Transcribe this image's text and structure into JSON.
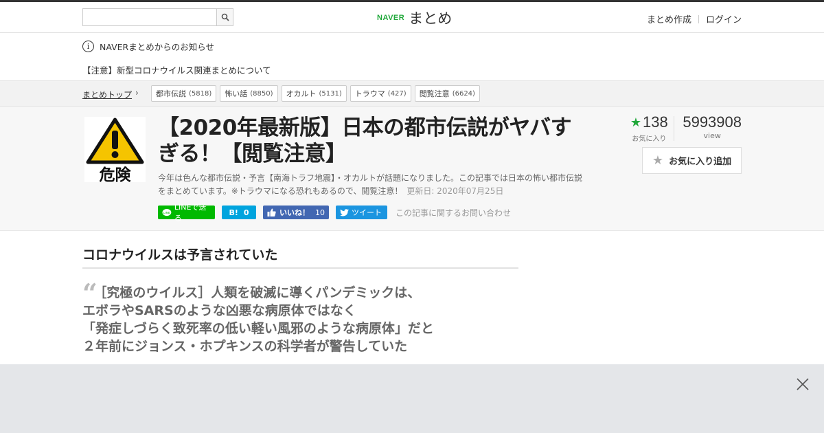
{
  "header": {
    "logo_naver": "NAVER",
    "logo_matome": "まとめ",
    "search_placeholder": "",
    "create_link": "まとめ作成",
    "login_link": "ログイン"
  },
  "notice": {
    "title": "NAVERまとめからのお知らせ",
    "item": "【注意】新型コロナウイルス関連まとめについて"
  },
  "breadcrumb": {
    "home": "まとめトップ",
    "tags": [
      {
        "label": "都市伝説",
        "count": "(5818)"
      },
      {
        "label": "怖い話",
        "count": "(8850)"
      },
      {
        "label": "オカルト",
        "count": "(5131)"
      },
      {
        "label": "トラウマ",
        "count": "(427)"
      },
      {
        "label": "閲覧注意",
        "count": "(6624)"
      }
    ]
  },
  "article": {
    "thumb_text": "危険",
    "title": "【2020年最新版】日本の都市伝説がヤバすぎる！【閲覧注意】",
    "description": "今年は色んな都市伝説・予言【南海トラフ地震】・オカルトが話題になりました。この記事では日本の怖い都市伝説をまとめています。※トラウマになる恐れもあるので、閲覧注意！",
    "updated": "更新日: 2020年07月25日",
    "favorites": "138",
    "favorites_label": "お気に入り",
    "views": "5993908",
    "views_label": "view",
    "fav_button": "お気に入り追加",
    "contact": "この記事に関するお問い合わせ"
  },
  "share": {
    "line": "LINEで送る",
    "hatena_icon": "B!",
    "hatena_count": "0",
    "fb_like": "いいね！",
    "fb_count": "10",
    "tweet": "ツイート"
  },
  "content": {
    "heading": "コロナウイルスは予言されていた",
    "quote_lines": [
      "［究極のウイルス］人類を破滅に導くパンデミックは、",
      "エボラやSARSのような凶悪な病原体ではなく",
      "「発症しづらく致死率の低い軽い風邪のような病原体」だと",
      "２年前にジョンス・ホプキンスの科学者が警告していた"
    ]
  },
  "colors": {
    "brand_green": "#20a83a",
    "line_green": "#00b900",
    "hatena_blue": "#00a4de",
    "facebook_blue": "#4267b2",
    "twitter_blue": "#1b95e0"
  }
}
